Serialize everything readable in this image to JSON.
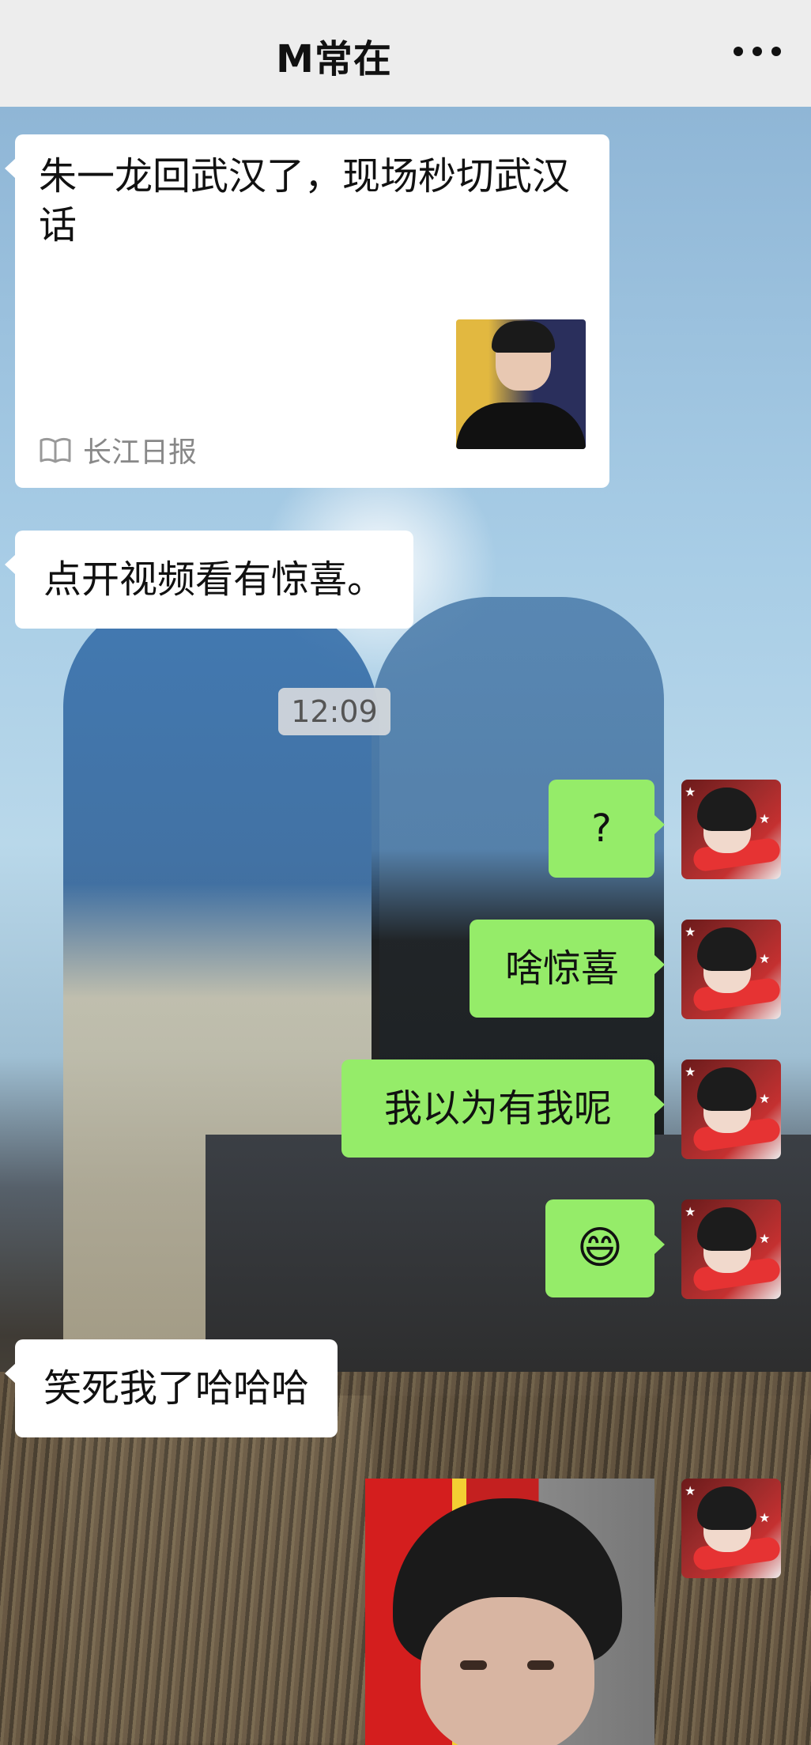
{
  "header": {
    "title": "M常在",
    "more_icon": "more-dots-icon"
  },
  "messages": {
    "article": {
      "title": "朱一龙回武汉了，现场秒切武汉话",
      "source": "长江日报"
    },
    "in_1": "点开视频看有惊喜。",
    "timestamp": "12:09",
    "out_1": "?",
    "out_2": "啥惊喜",
    "out_3": "我以为有我呢",
    "out_4_emoji": "😄",
    "in_2": "笑死我了哈哈哈"
  },
  "colors": {
    "outgoing_bubble": "#95ec69",
    "incoming_bubble": "#ffffff",
    "header_bg": "#ededed"
  }
}
